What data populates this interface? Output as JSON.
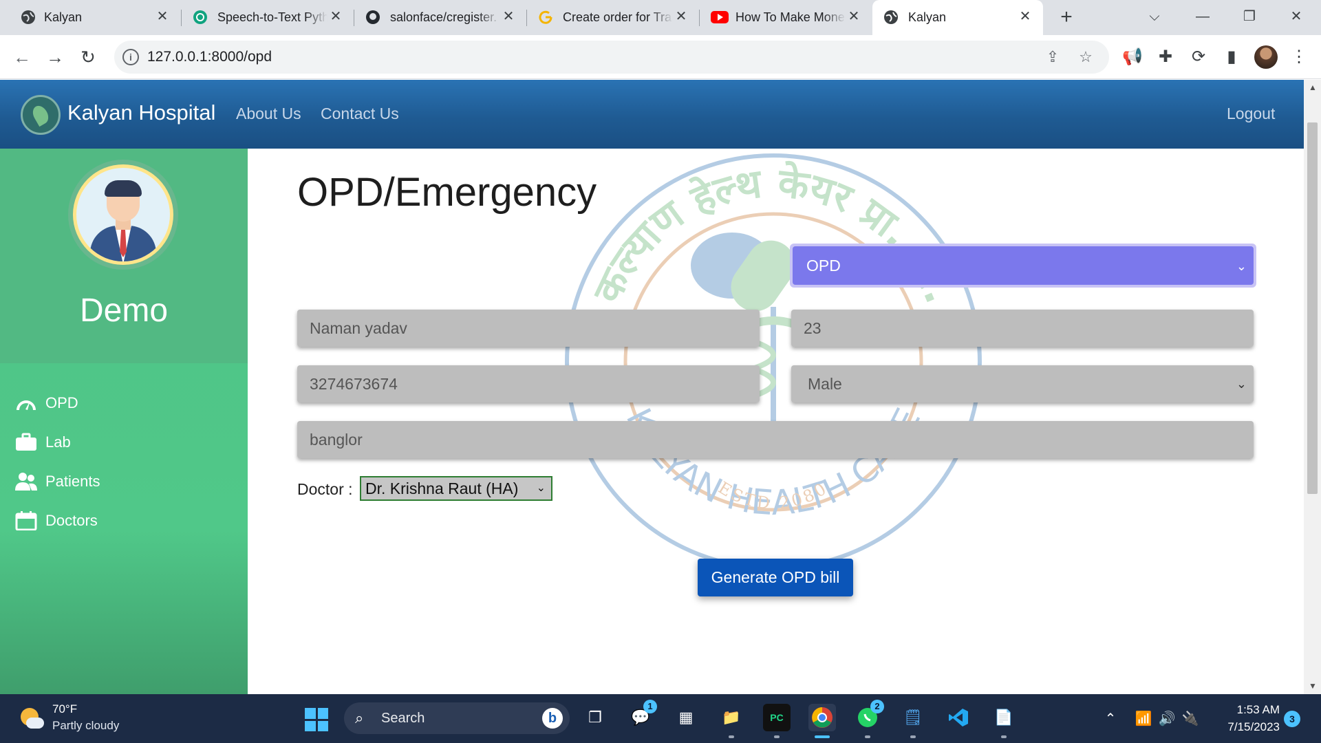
{
  "browser": {
    "tabs": [
      {
        "title": "Kalyan",
        "favicon": "globe-icon"
      },
      {
        "title": "Speech-to-Text Pyth",
        "favicon": "chatgpt-icon"
      },
      {
        "title": "salonface/cregister.",
        "favicon": "github-icon"
      },
      {
        "title": "Create order for Tra",
        "favicon": "google-icon"
      },
      {
        "title": "How To Make Mone",
        "favicon": "youtube-icon"
      },
      {
        "title": "Kalyan",
        "favicon": "globe-icon",
        "active": true
      }
    ],
    "url": "127.0.0.1:8000/opd"
  },
  "navbar": {
    "brand": "Kalyan Hospital",
    "links": [
      "About Us",
      "Contact Us"
    ],
    "logout": "Logout"
  },
  "sidebar": {
    "username": "Demo",
    "items": [
      {
        "label": "OPD",
        "icon": "gauge-icon"
      },
      {
        "label": "Lab",
        "icon": "briefcase-icon"
      },
      {
        "label": "Patients",
        "icon": "users-icon"
      },
      {
        "label": "Doctors",
        "icon": "calendar-icon"
      }
    ]
  },
  "watermark": {
    "top_text": "कल्याण हेल्थ केयर प्रा. लि.",
    "bottom_text": "KALYAN HEALTH CARE",
    "estd": "ESTD 2080"
  },
  "form": {
    "title": "OPD/Emergency",
    "type_selected": "OPD",
    "name": "Naman yadav",
    "age": "23",
    "phone": "3274673674",
    "gender": "Male",
    "address": "banglor",
    "doctor_label": "Doctor :",
    "doctor_selected": "Dr. Krishna Raut (HA)",
    "submit_label": "Generate OPD bill",
    "accent_color": "#7b78ec",
    "button_color": "#0b55b8"
  },
  "taskbar": {
    "temperature": "70°F",
    "weather": "Partly cloudy",
    "search_placeholder": "Search",
    "teams_badge": "1",
    "whatsapp_badge": "2",
    "time": "1:53 AM",
    "date": "7/15/2023",
    "notifications": "3"
  }
}
